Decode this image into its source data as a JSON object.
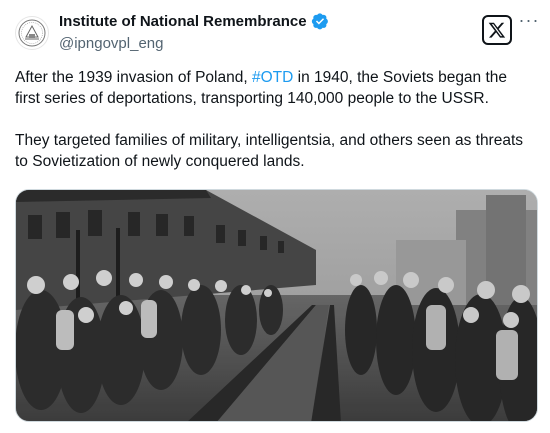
{
  "author": {
    "display_name": "Institute of National Remembrance",
    "handle": "@ipngovpl_eng",
    "verified": true
  },
  "icons": {
    "avatar": "ipn-seal-logo",
    "verified": "verified-badge-icon",
    "brand": "x-logo-icon",
    "more": "more-options-icon"
  },
  "colors": {
    "text": "#0f1419",
    "secondary": "#536471",
    "link": "#1d9bf0",
    "verified": "#1d9bf0"
  },
  "tweet": {
    "p1_before": "After the 1939 invasion of Poland, ",
    "hashtag": "#OTD",
    "p1_after": " in 1940, the Soviets began the first series of deportations, transporting 140,000 people to the USSR.",
    "p2": "They targeted families of military, intelligentsia, and others seen as threats to Sovietization of newly conquered lands."
  },
  "media": {
    "type": "photo",
    "style": "black-and-white"
  }
}
